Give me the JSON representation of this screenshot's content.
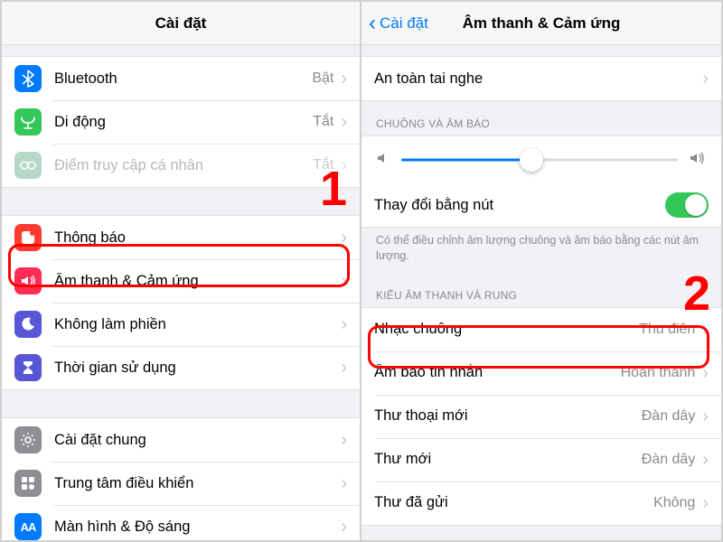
{
  "left": {
    "title": "Cài đặt",
    "group1": [
      {
        "icon": "bluetooth-icon",
        "label": "Bluetooth",
        "value": "Bật",
        "bg": "bg-blue"
      },
      {
        "icon": "cellular-icon",
        "label": "Di động",
        "value": "Tắt",
        "bg": "bg-green"
      },
      {
        "icon": "hotspot-icon",
        "label": "Điểm truy cập cá nhân",
        "value": "Tắt",
        "bg": "bg-greengrey",
        "disabled": true
      }
    ],
    "group2": [
      {
        "icon": "notify-icon",
        "label": "Thông báo",
        "bg": "bg-red"
      },
      {
        "icon": "sound-icon",
        "label": "Âm thanh & Cảm ứng",
        "bg": "bg-redsound",
        "highlighted": true
      },
      {
        "icon": "moon-icon",
        "label": "Không làm phiền",
        "bg": "bg-purple"
      },
      {
        "icon": "hourglass-icon",
        "label": "Thời gian sử dụng",
        "bg": "bg-indigo"
      }
    ],
    "group3": [
      {
        "icon": "gear-icon",
        "label": "Cài đặt chung",
        "bg": "bg-grey"
      },
      {
        "icon": "control-icon",
        "label": "Trung tâm điều khiển",
        "bg": "bg-grey"
      },
      {
        "icon": "display-icon",
        "label": "Màn hình & Độ sáng",
        "bg": "bg-bluealt"
      }
    ],
    "annotation": "1"
  },
  "right": {
    "back_label": "Cài đặt",
    "title": "Âm thanh & Cảm ứng",
    "row_safety": "An toàn tai nghe",
    "header_ringer": "CHUÔNG VÀ ÂM BÁO",
    "slider_value_pct": 47,
    "row_change_buttons": "Thay đổi bằng nút",
    "switch_on": true,
    "footer_ringer": "Có thể điều chỉnh âm lượng chuông và âm báo bằng các nút âm lượng.",
    "header_sounds": "KIỂU ÂM THANH VÀ RUNG",
    "rows_sounds": [
      {
        "label": "Nhạc chuông",
        "value": "Thu điên",
        "highlighted": true
      },
      {
        "label": "Âm báo tin nhắn",
        "value": "Hoàn thành"
      },
      {
        "label": "Thư thoại mới",
        "value": "Đàn dây"
      },
      {
        "label": "Thư mới",
        "value": "Đàn dây"
      },
      {
        "label": "Thư đã gửi",
        "value": "Không"
      }
    ],
    "annotation": "2"
  }
}
